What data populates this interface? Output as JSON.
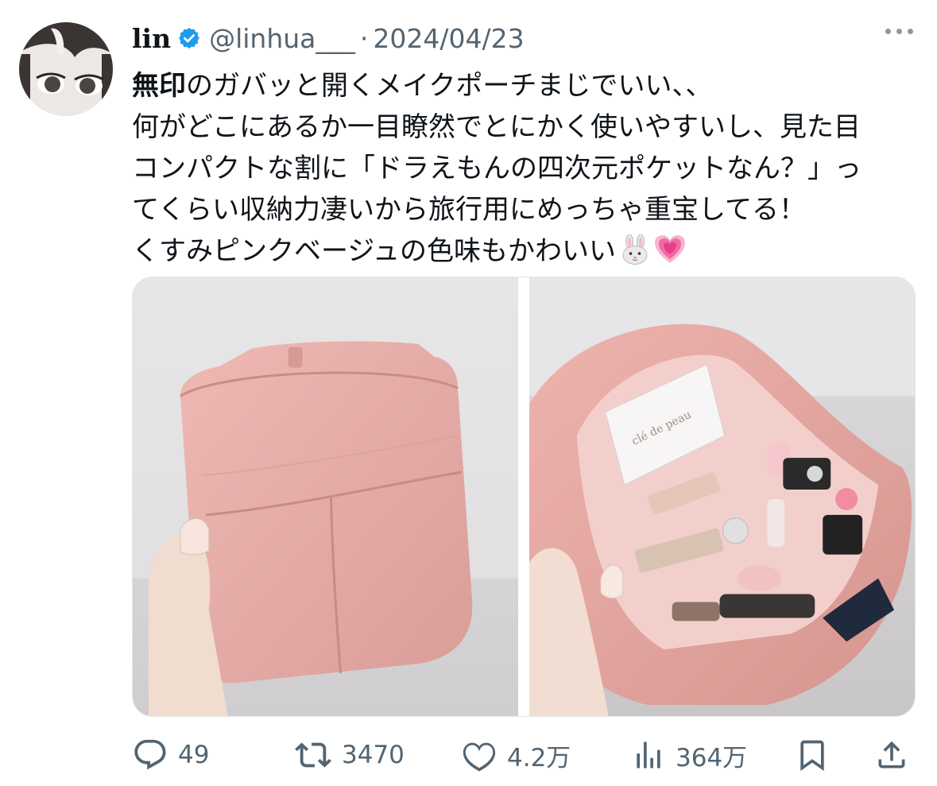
{
  "tweet": {
    "author": {
      "display_name": "lin",
      "handle": "@linhua___",
      "verified": true
    },
    "separator": "·",
    "date": "2024/04/23",
    "text": {
      "bold_prefix": "無印",
      "line1_rest": "のガバッと開くメイクポーチまじでいい、、",
      "line2": "何がどこにあるか一目瞭然でとにかく使いやすいし、見た目",
      "line3": "コンパクトな割に「ドラえもんの四次元ポケットなん？」っ",
      "line4": "てくらい収納力凄いから旅行用にめっちゃ重宝してる！",
      "line5": "くすみピンクベージュの色味もかわいい"
    },
    "emojis": [
      "rabbit-face",
      "growing-heart"
    ],
    "media": [
      {
        "name": "closed-pink-pouch-photo"
      },
      {
        "name": "open-pink-pouch-with-makeup-photo",
        "visible_brand_text": "clé de peau"
      }
    ],
    "metrics": {
      "replies": "49",
      "retweets": "3470",
      "likes": "4.2万",
      "views": "364万"
    }
  },
  "colors": {
    "text": "#0f1419",
    "secondary": "#536471",
    "verified": "#1d9bf0",
    "pouch_pink": "#e6aaa6",
    "heart_pink": "#f06aa3"
  }
}
